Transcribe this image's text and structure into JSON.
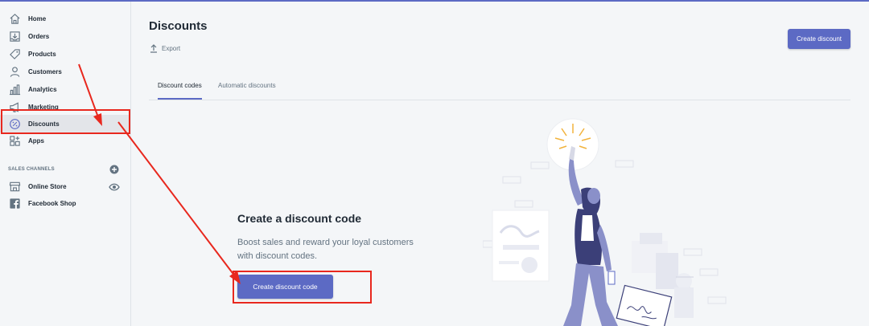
{
  "sidebar": {
    "items": [
      {
        "label": "Home",
        "icon": "home-icon"
      },
      {
        "label": "Orders",
        "icon": "orders-icon"
      },
      {
        "label": "Products",
        "icon": "tag-icon"
      },
      {
        "label": "Customers",
        "icon": "person-icon"
      },
      {
        "label": "Analytics",
        "icon": "bar-chart-icon"
      },
      {
        "label": "Marketing",
        "icon": "megaphone-icon"
      },
      {
        "label": "Discounts",
        "icon": "discount-icon"
      },
      {
        "label": "Apps",
        "icon": "apps-icon"
      }
    ],
    "active_item": "Discounts",
    "sales_channels_title": "SALES CHANNELS",
    "channels": [
      {
        "label": "Online Store",
        "icon": "store-icon"
      },
      {
        "label": "Facebook Shop",
        "icon": "facebook-icon"
      }
    ]
  },
  "header": {
    "title": "Discounts",
    "export_label": "Export",
    "create_button": "Create discount"
  },
  "tabs": [
    {
      "label": "Discount codes",
      "active": true
    },
    {
      "label": "Automatic discounts",
      "active": false
    }
  ],
  "empty_state": {
    "title": "Create a discount code",
    "description": "Boost sales and reward your loyal customers with discount codes.",
    "button": "Create discount code"
  },
  "colors": {
    "accent": "#5c6ac4",
    "annotation": "#e8281e",
    "background": "#f4f6f8"
  }
}
